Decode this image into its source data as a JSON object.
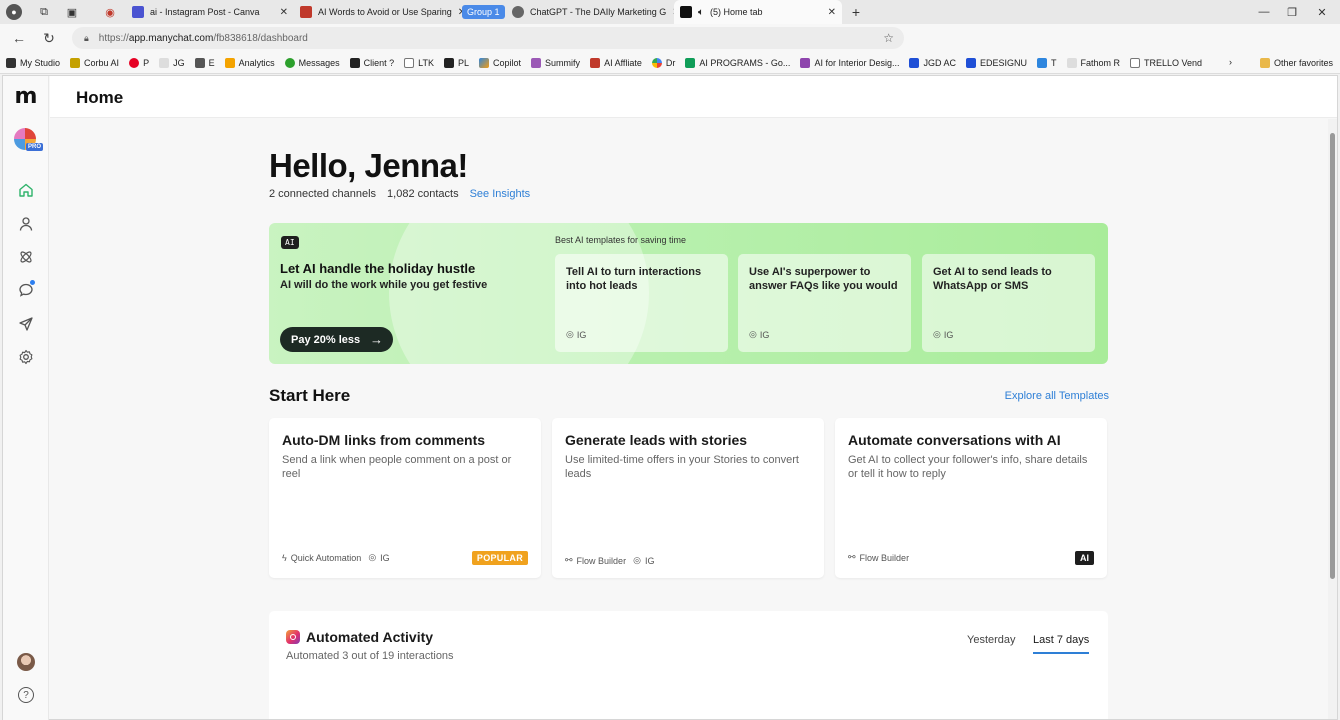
{
  "browser": {
    "tabs": [
      {
        "title": "ai - Instagram Post - Canva",
        "color": "#4a53d1"
      },
      {
        "title": "AI Words to Avoid or Use Sparing",
        "color": "#c0392b"
      },
      {
        "title": "ChatGPT - The DAIly Marketing G",
        "color": "#555555"
      },
      {
        "title": "(5) Home tab",
        "color": "#111111"
      }
    ],
    "group_label": "Group 1",
    "url_prefix": "https://",
    "url_host": "app.manychat.com",
    "url_path": "/fb838618/dashboard",
    "bookmarks": [
      {
        "label": "My Studio",
        "color": "#333333"
      },
      {
        "label": "Corbu AI",
        "color": "#c4a000"
      },
      {
        "label": "P",
        "color": "#e60023"
      },
      {
        "label": "JG",
        "color": "#cccccc"
      },
      {
        "label": "E",
        "color": "#555555"
      },
      {
        "label": "Analytics",
        "color": "#f4a300"
      },
      {
        "label": "Messages",
        "color": "#2ca02c"
      },
      {
        "label": "Client ?",
        "color": "#222222"
      },
      {
        "label": "LTK",
        "color": "#888888"
      },
      {
        "label": "PL",
        "color": "#222222"
      },
      {
        "label": "Copilot",
        "color": "#6b5bd6"
      },
      {
        "label": "Summify",
        "color": "#9b59b6"
      },
      {
        "label": "AI Affliate",
        "color": "#c0392b"
      },
      {
        "label": "Dr",
        "color": "#4285f4"
      },
      {
        "label": "AI PROGRAMS - Go...",
        "color": "#0f9d58"
      },
      {
        "label": "AI for Interior Desig...",
        "color": "#8e44ad"
      },
      {
        "label": "JGD AC",
        "color": "#1f4fd6"
      },
      {
        "label": "EDESIGNU",
        "color": "#1f4fd6"
      },
      {
        "label": "T",
        "color": "#2e86de"
      },
      {
        "label": "Fathom R",
        "color": "#cccccc"
      },
      {
        "label": "TRELLO Vend",
        "color": "#888888"
      }
    ],
    "other_favorites": "Other favorites"
  },
  "app": {
    "page_title": "Home",
    "greeting": "Hello, Jenna!",
    "stats": {
      "channels": "2 connected channels",
      "contacts": "1,082 contacts",
      "insights_link": "See Insights"
    },
    "ai_banner": {
      "tag": "AI",
      "headline": "Let AI handle the holiday hustle",
      "subline": "AI will do the work while you get festive",
      "cta": "Pay 20% less",
      "templates_caption": "Best AI templates for saving time",
      "templates": [
        {
          "title": "Tell AI to turn interactions into hot leads",
          "channel": "IG"
        },
        {
          "title": "Use AI's superpower to answer FAQs like you would",
          "channel": "IG"
        },
        {
          "title": "Get AI to send leads to WhatsApp or SMS",
          "channel": "IG"
        }
      ]
    },
    "start_here": {
      "title": "Start Here",
      "explore_link": "Explore all Templates",
      "cards": [
        {
          "title": "Auto-DM links from comments",
          "desc": "Send a link when people comment on a post or reel",
          "meta": "Quick Automation",
          "channel": "IG",
          "badge": "POPULAR"
        },
        {
          "title": "Generate leads with stories",
          "desc": "Use limited-time offers in your Stories to convert leads",
          "meta": "Flow Builder",
          "channel": "IG",
          "badge": ""
        },
        {
          "title": "Automate conversations with AI",
          "desc": "Get AI to collect your follower's info, share details or tell it how to reply",
          "meta": "Flow Builder",
          "channel": "",
          "badge": "AI"
        }
      ]
    },
    "activity": {
      "title": "Automated Activity",
      "subtitle": "Automated 3 out of 19 interactions",
      "tabs": [
        "Yesterday",
        "Last 7 days"
      ],
      "active_tab": "Last 7 days"
    },
    "colors": {
      "accent": "#2e7fd6",
      "banner_green": "#b8f0ae",
      "popular": "#f0a21e",
      "home_icon_active": "#2fb36b"
    }
  }
}
